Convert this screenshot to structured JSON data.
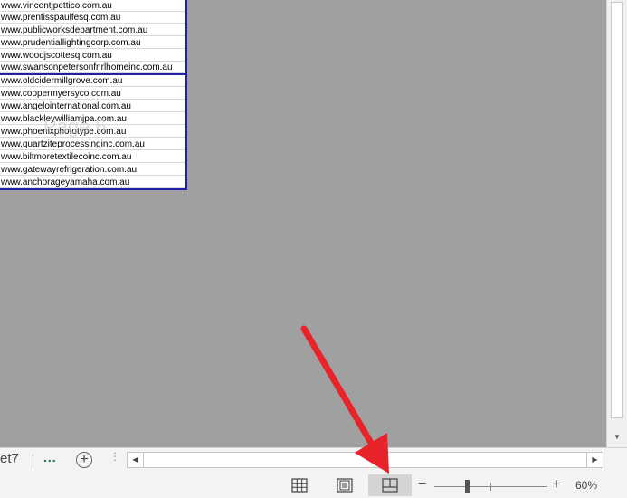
{
  "sheet": {
    "rows": [
      "www.vincentjpettico.com.au",
      "www.prentisspaulfesq.com.au",
      "www.publicworksdepartment.com.au",
      "www.prudentiallightingcorp.com.au",
      "www.woodjscottesq.com.au",
      "www.swansonpetersonfnrlhomeinc.com.au",
      "www.oldcidermillgrove.com.au",
      "www.coopermyersyco.com.au",
      "www.angelointernational.com.au",
      "www.blackleywilliamjpa.com.au",
      "www.phoenixphototype.com.au",
      "www.quartziteprocessinginc.com.au",
      "www.biltmoretextilecoinc.com.au",
      "www.gatewayrefrigeration.com.au",
      "www.anchorageyamaha.com.au"
    ],
    "page_watermark": "Page 6"
  },
  "tabs": {
    "sheet_tab": "et7",
    "more_tabs": "...",
    "add_sheet": "+"
  },
  "status": {
    "zoom_minus": "−",
    "zoom_plus": "+",
    "zoom_level": "60%"
  },
  "colors": {
    "page_break_line": "#1f1fa8",
    "sheet_background": "#a0a0a0",
    "annotation_arrow": "#e8232a",
    "active_view_button": "#d4d4d4"
  },
  "icons": {
    "normal_view": "grid-icon",
    "page_layout_view": "page-layout-icon",
    "page_break_view": "page-break-preview-icon"
  }
}
